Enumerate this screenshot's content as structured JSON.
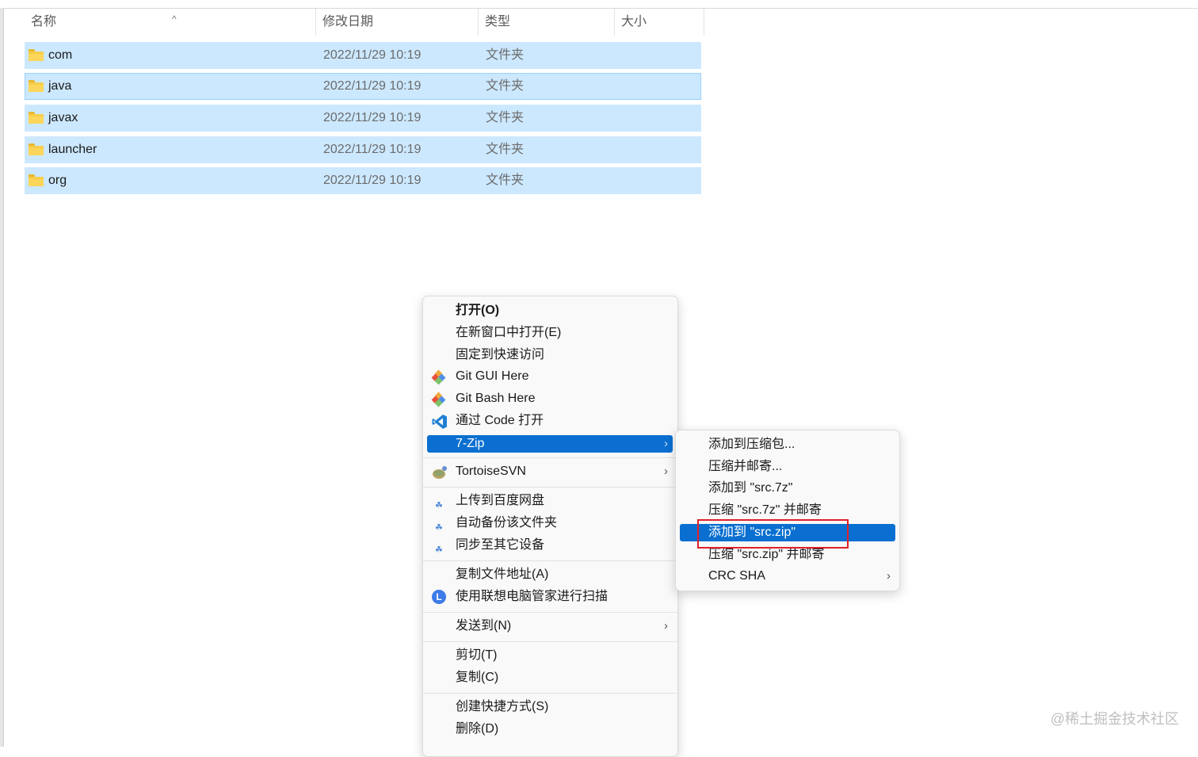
{
  "columns": {
    "name": "名称",
    "date": "修改日期",
    "type": "类型",
    "size": "大小"
  },
  "files": [
    {
      "name": "com",
      "date": "2022/11/29 10:19",
      "type": "文件夹"
    },
    {
      "name": "java",
      "date": "2022/11/29 10:19",
      "type": "文件夹"
    },
    {
      "name": "javax",
      "date": "2022/11/29 10:19",
      "type": "文件夹"
    },
    {
      "name": "launcher",
      "date": "2022/11/29 10:19",
      "type": "文件夹"
    },
    {
      "name": "org",
      "date": "2022/11/29 10:19",
      "type": "文件夹"
    }
  ],
  "context_menu": {
    "open": "打开(O)",
    "open_new_window": "在新窗口中打开(E)",
    "pin_quick_access": "固定到快速访问",
    "git_gui": "Git GUI Here",
    "git_bash": "Git Bash Here",
    "open_with_code": "通过 Code 打开",
    "seven_zip": "7-Zip",
    "tortoise_svn": "TortoiseSVN",
    "upload_baidu": "上传到百度网盘",
    "auto_backup": "自动备份该文件夹",
    "sync_devices": "同步至其它设备",
    "copy_path": "复制文件地址(A)",
    "lenovo_scan": "使用联想电脑管家进行扫描",
    "send_to": "发送到(N)",
    "cut": "剪切(T)",
    "copy": "复制(C)",
    "create_shortcut": "创建快捷方式(S)",
    "delete": "删除(D)"
  },
  "submenu_7zip": {
    "add_archive": "添加到压缩包...",
    "compress_email": "压缩并邮寄...",
    "add_7z": "添加到 \"src.7z\"",
    "compress_7z_email": "压缩 \"src.7z\" 并邮寄",
    "add_zip": "添加到 \"src.zip\"",
    "compress_zip_email": "压缩 \"src.zip\" 并邮寄",
    "crc_sha": "CRC SHA"
  },
  "watermark": "@稀土掘金技术社区",
  "colors": {
    "selection": "#cce8ff",
    "menu_highlight": "#0a6fd0",
    "annotation_box": "#e0202a"
  }
}
